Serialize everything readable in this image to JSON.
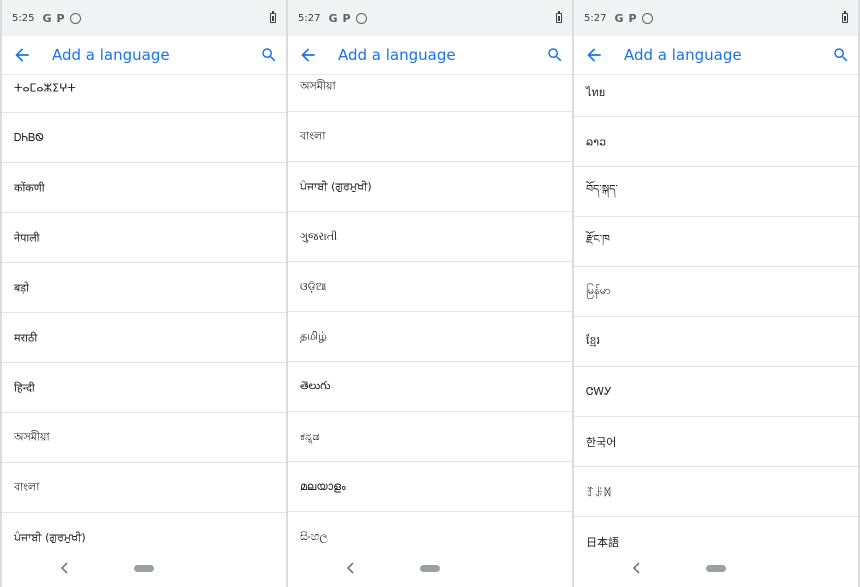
{
  "colors": {
    "accent": "#1a73e8",
    "status_bar_bg": "#f1f3f4",
    "divider": "#e4e4e4"
  },
  "screens": [
    {
      "status": {
        "time": "5:25",
        "icons": [
          "G",
          "P"
        ]
      },
      "app_bar": {
        "back_icon": "arrow-back-icon",
        "title": "Add a language",
        "search_icon": "search-icon"
      },
      "languages": [
        "ⵜⴰⵎⴰⵣⵉⵖⵜ",
        "ᎠᏂᏴᏫ",
        "कोंकणी",
        "नेपाली",
        "बड़ो",
        "मराठी",
        "हिन्दी",
        "অসমীয়া",
        "বাংলা",
        "ਪੰਜਾਬੀ (ਗੁਰਮੁਖੀ)"
      ]
    },
    {
      "status": {
        "time": "5:27",
        "icons": [
          "G",
          "P"
        ]
      },
      "app_bar": {
        "back_icon": "arrow-back-icon",
        "title": "Add a language",
        "search_icon": "search-icon"
      },
      "languages": [
        "অসমীয়া",
        "বাংলা",
        "ਪੰਜਾਬੀ (ਗੁਰਮੁਖੀ)",
        "ગુજરાતી",
        "ଓଡ଼ିଆ",
        "தமிழ்",
        "తెలుగు",
        "ಕನ್ನಡ",
        "മലയാളം",
        "සිංහල"
      ]
    },
    {
      "status": {
        "time": "5:27",
        "icons": [
          "G",
          "P"
        ]
      },
      "app_bar": {
        "back_icon": "arrow-back-icon",
        "title": "Add a language",
        "search_icon": "search-icon"
      },
      "languages": [
        "ไทย",
        "ລາວ",
        "བོད་སྐད་",
        "རྫོང་ཁ",
        "မြန်မာ",
        "ខ្មែរ",
        "ᏣᎳᎩ",
        "한국어",
        "ꆈꌠꉙ",
        "日本語"
      ]
    }
  ]
}
